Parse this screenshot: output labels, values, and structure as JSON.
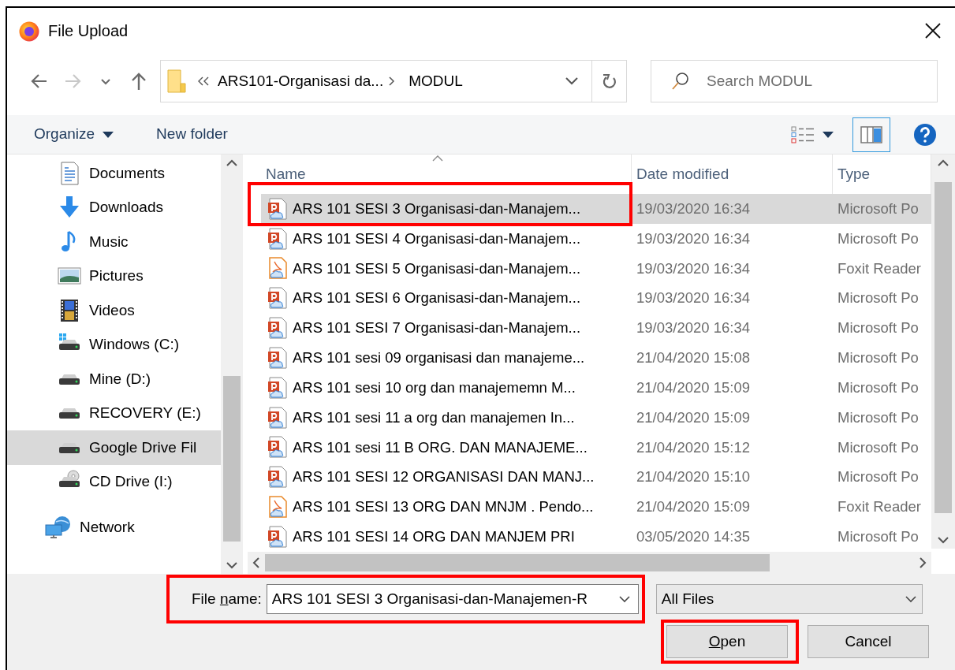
{
  "window": {
    "title": "File Upload"
  },
  "nav_buttons": [
    {
      "kind": "back",
      "disabled": false
    },
    {
      "kind": "forward",
      "disabled": true
    },
    {
      "kind": "recent",
      "disabled": false
    },
    {
      "kind": "up",
      "disabled": false
    }
  ],
  "address": {
    "crumbs": [
      "ARS101-Organisasi da...",
      "MODUL"
    ]
  },
  "search": {
    "placeholder": "Search MODUL"
  },
  "toolbar": {
    "organize": "Organize",
    "new_folder": "New folder",
    "preview_pane_selected": true
  },
  "sidebar": {
    "pc_items": [
      {
        "label": "Documents",
        "kind": "documents",
        "selected": false
      },
      {
        "label": "Downloads",
        "kind": "downloads",
        "selected": false
      },
      {
        "label": "Music",
        "kind": "music",
        "selected": false
      },
      {
        "label": "Pictures",
        "kind": "pictures",
        "selected": false
      },
      {
        "label": "Videos",
        "kind": "videos",
        "selected": false
      },
      {
        "label": "Windows (C:)",
        "kind": "system-drive",
        "selected": false
      },
      {
        "label": "Mine (D:)",
        "kind": "drive",
        "selected": false
      },
      {
        "label": "RECOVERY (E:)",
        "kind": "drive",
        "selected": false
      },
      {
        "label": "Google Drive Fil",
        "kind": "drive",
        "selected": true
      },
      {
        "label": "CD Drive (I:)",
        "kind": "cd-drive",
        "selected": false
      }
    ],
    "root_items": [
      {
        "label": "Network",
        "kind": "network",
        "selected": false
      }
    ]
  },
  "files": {
    "columns": [
      "Name",
      "Date modified",
      "Type"
    ],
    "rows": [
      {
        "name": "ARS 101 SESI 3 Organisasi-dan-Manajem...",
        "date": "19/03/2020 16:34",
        "type": "Microsoft Po",
        "kind": "pptx",
        "selected": true,
        "highlighted": true
      },
      {
        "name": "ARS 101 SESI 4  Organisasi-dan-Manajem...",
        "date": "19/03/2020 16:34",
        "type": "Microsoft Po",
        "kind": "pptx",
        "selected": false,
        "highlighted": false
      },
      {
        "name": "ARS 101 SESI 5  Organisasi-dan-Manajem...",
        "date": "19/03/2020 16:34",
        "type": "Foxit Reader",
        "kind": "pdf",
        "selected": false,
        "highlighted": false
      },
      {
        "name": "ARS 101 SESI 6 Organisasi-dan-Manajem...",
        "date": "19/03/2020 16:34",
        "type": "Microsoft Po",
        "kind": "pptx",
        "selected": false,
        "highlighted": false
      },
      {
        "name": "ARS 101 SESI 7 Organisasi-dan-Manajem...",
        "date": "19/03/2020 16:34",
        "type": "Microsoft Po",
        "kind": "pptx",
        "selected": false,
        "highlighted": false
      },
      {
        "name": "ARS 101 sesi 09 organisasi dan manajeme...",
        "date": "21/04/2020 15:08",
        "type": "Microsoft Po",
        "kind": "pptx",
        "selected": false,
        "highlighted": false
      },
      {
        "name": "ARS 101 sesi 10 org dan manajememn M...",
        "date": "21/04/2020 15:09",
        "type": "Microsoft Po",
        "kind": "pptx",
        "selected": false,
        "highlighted": false
      },
      {
        "name": "ARS 101 sesi 11 a  org dan manajemen In...",
        "date": "21/04/2020 15:09",
        "type": "Microsoft Po",
        "kind": "pptx",
        "selected": false,
        "highlighted": false
      },
      {
        "name": "ARS 101 sesi 11 B ORG. DAN MANAJEME...",
        "date": "21/04/2020 15:12",
        "type": "Microsoft Po",
        "kind": "pptx",
        "selected": false,
        "highlighted": false
      },
      {
        "name": "ARS 101 SESI 12  ORGANISASI DAN MANJ...",
        "date": "21/04/2020 15:10",
        "type": "Microsoft Po",
        "kind": "pptx",
        "selected": false,
        "highlighted": false
      },
      {
        "name": "ARS 101 SESI 13 ORG DAN MNJM . Pendo...",
        "date": "21/04/2020 15:09",
        "type": "Foxit Reader",
        "kind": "pdf",
        "selected": false,
        "highlighted": false
      },
      {
        "name": "ARS 101 SESI 14  ORG DAN MANJEM PRI",
        "date": "03/05/2020 14:35",
        "type": "Microsoft Po",
        "kind": "pptx",
        "selected": false,
        "highlighted": false
      }
    ]
  },
  "footer": {
    "file_name": {
      "label_pre": "File ",
      "label_key": "n",
      "label_post": "ame:",
      "value": "ARS 101 SESI 3 Organisasi-dan-Manajemen-R",
      "highlighted": true
    },
    "file_type": "All Files",
    "buttons": [
      {
        "label_key": "O",
        "label_post": "pen",
        "highlighted": true
      },
      {
        "label_post": "Cancel",
        "highlighted": false
      }
    ]
  }
}
